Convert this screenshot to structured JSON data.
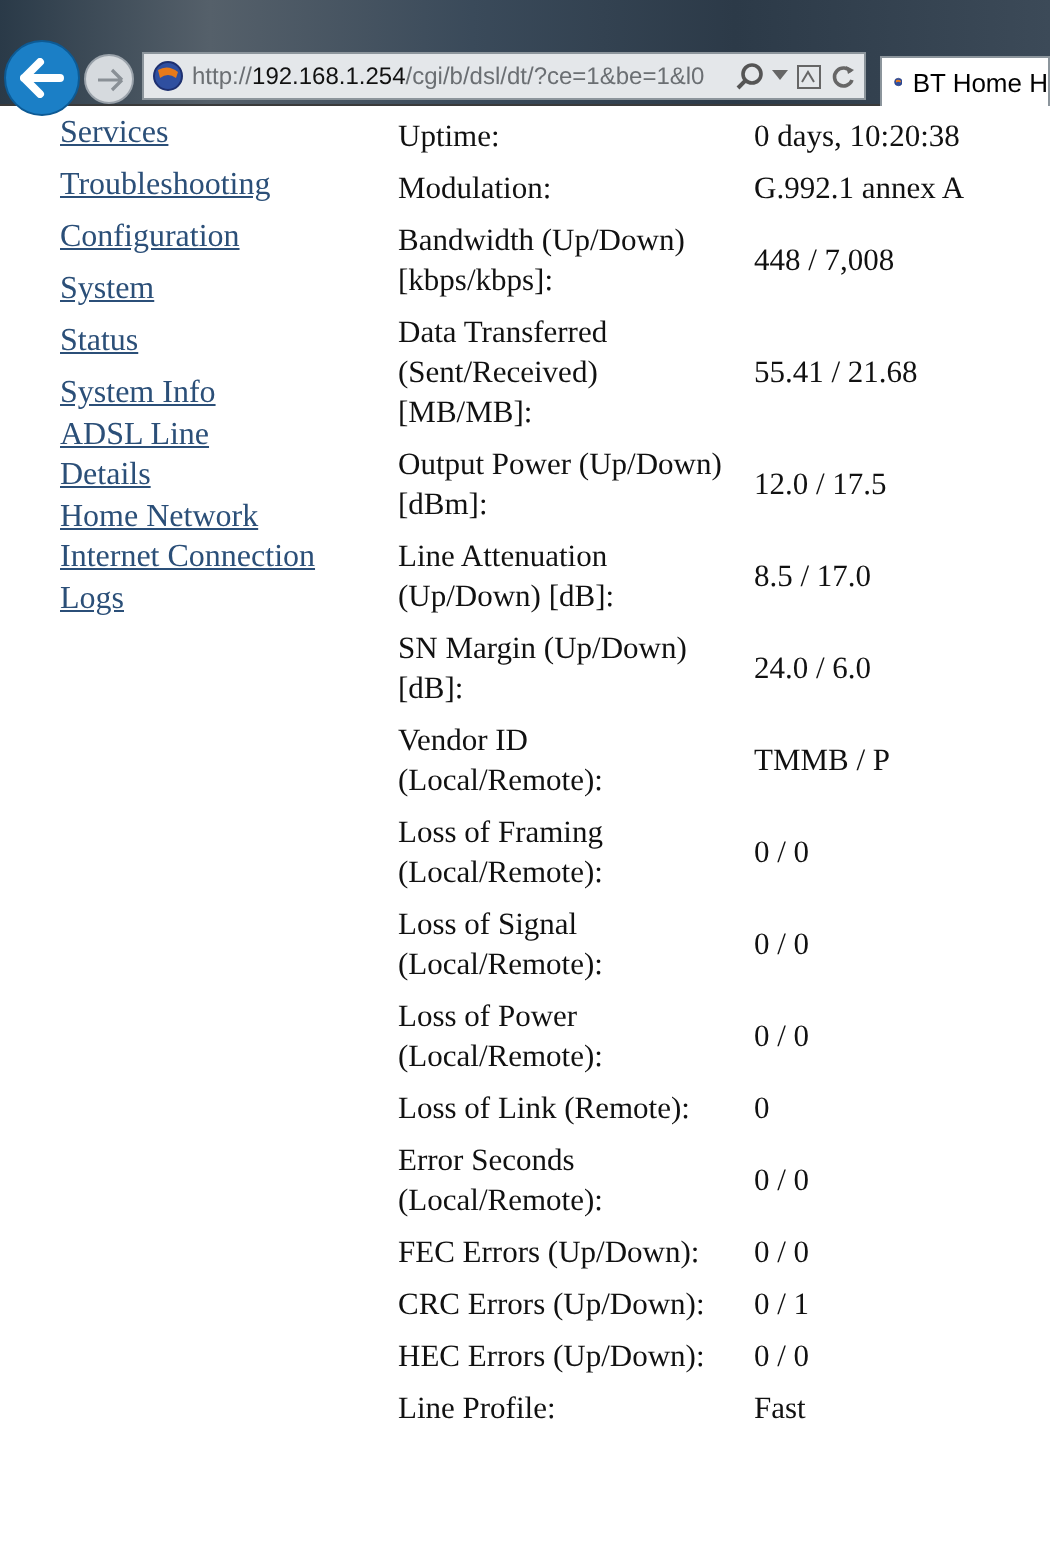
{
  "browser": {
    "url_scheme": "http://",
    "url_host": "192.168.1.254",
    "url_path": "/cgi/b/dsl/dt/?ce=1&be=1&l0",
    "tab_title": "BT Home H"
  },
  "sidebar": {
    "items": [
      {
        "label": "Services",
        "kind": "section"
      },
      {
        "label": "Troubleshooting",
        "kind": "section"
      },
      {
        "label": "Configuration",
        "kind": "section"
      },
      {
        "label": "System",
        "kind": "section"
      },
      {
        "label": "Status",
        "kind": "section"
      },
      {
        "label": "System Info",
        "kind": "page"
      },
      {
        "label": "ADSL Line",
        "kind": "page"
      },
      {
        "label": "Details",
        "kind": "page"
      },
      {
        "label": "Home Network",
        "kind": "page"
      },
      {
        "label": "Internet Connection",
        "kind": "page"
      },
      {
        "label": "Logs",
        "kind": "page"
      }
    ]
  },
  "stats": [
    {
      "label": "Uptime:",
      "value": "0 days, 10:20:38"
    },
    {
      "label": "Modulation:",
      "value": "G.992.1 annex A"
    },
    {
      "label": "Bandwidth (Up/Down) [kbps/kbps]:",
      "value": "448 / 7,008"
    },
    {
      "label": "Data Transferred (Sent/Received) [MB/MB]:",
      "value": "55.41 / 21.68"
    },
    {
      "label": "Output Power (Up/Down) [dBm]:",
      "value": "12.0 / 17.5"
    },
    {
      "label": "Line Attenuation (Up/Down) [dB]:",
      "value": "8.5 / 17.0"
    },
    {
      "label": "SN Margin (Up/Down) [dB]:",
      "value": "24.0 / 6.0"
    },
    {
      "label": "Vendor ID (Local/Remote):",
      "value": "TMMB / P"
    },
    {
      "label": "Loss of Framing (Local/Remote):",
      "value": "0 / 0"
    },
    {
      "label": "Loss of Signal (Local/Remote):",
      "value": "0 / 0"
    },
    {
      "label": "Loss of Power (Local/Remote):",
      "value": "0 / 0"
    },
    {
      "label": "Loss of Link (Remote):",
      "value": "0"
    },
    {
      "label": "Error Seconds (Local/Remote):",
      "value": "0 / 0"
    },
    {
      "label": "FEC Errors (Up/Down):",
      "value": "0 / 0"
    },
    {
      "label": "CRC Errors (Up/Down):",
      "value": "0 / 1"
    },
    {
      "label": "HEC Errors (Up/Down):",
      "value": "0 / 0"
    },
    {
      "label": "Line Profile:",
      "value": "Fast"
    }
  ]
}
